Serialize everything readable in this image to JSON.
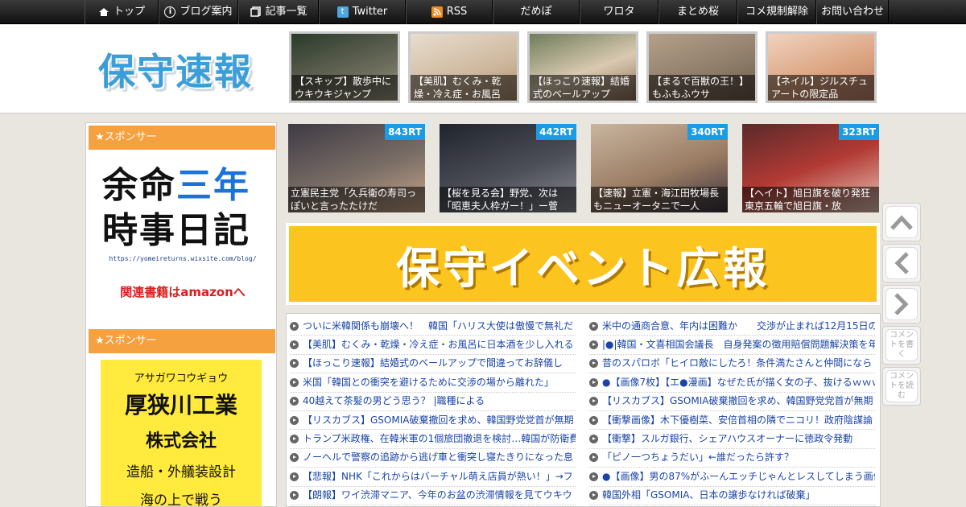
{
  "nav": {
    "items": [
      {
        "label": "トップ",
        "icon": "home-icon"
      },
      {
        "label": "ブログ案内",
        "icon": "info-icon"
      },
      {
        "label": "記事一覧",
        "icon": "list-icon"
      },
      {
        "label": "Twitter",
        "icon": "twitter-icon"
      },
      {
        "label": "RSS",
        "icon": "rss-icon"
      },
      {
        "label": "だめぽ"
      },
      {
        "label": "ワロタ"
      },
      {
        "label": "まとめ桜"
      },
      {
        "label": "コメ規制解除"
      },
      {
        "label": "お問い合わせ"
      }
    ]
  },
  "header": {
    "logo": "保守速報",
    "thumbs": [
      {
        "caption": "【スキップ】散歩中にウキウキジャンプ"
      },
      {
        "caption": "【美肌】むくみ・乾燥・冷え症・お風呂"
      },
      {
        "caption": "【ほっこり速報】結婚式のベールアップ"
      },
      {
        "caption": "【まるで百獣の王！】もふもふウサ"
      },
      {
        "caption": "【ネイル】ジルスチュアートの限定品"
      }
    ]
  },
  "sidebar": {
    "sponsor_label": "★スポンサー",
    "ad1": {
      "line1_a": "余命",
      "line1_b": "三年",
      "line2": "時事日記",
      "url": "https://yomeireturns.wixsite.com/blog/",
      "amazon": "関連書籍はamazonへ"
    },
    "ad2": {
      "kana": "アサガワコウギョウ",
      "company": "厚狭川工業",
      "company2": "株式会社",
      "business": "造船・外艤装設計",
      "more": "海の上で戦う"
    }
  },
  "rt_items": [
    {
      "rt": "843RT",
      "caption": "立憲民主党「久兵衛の寿司っぽいと言ったたけだ"
    },
    {
      "rt": "442RT",
      "caption": "【桜を見る会】野党、次は「昭恵夫人枠ガー！」ー菅"
    },
    {
      "rt": "340RT",
      "caption": "【速報】立憲・海江田牧場長もニューオータニで一人"
    },
    {
      "rt": "323RT",
      "caption": "【ヘイト】旭日旗を破り発狂　東京五輪で旭日旗・放"
    }
  ],
  "banner": {
    "text": "保守イベント広報"
  },
  "headlines_left": [
    "ついに米韓関係も崩壊へ！　韓国「ハリス大使は傲慢で無礼だ",
    "【美肌】むくみ・乾燥・冷え症・お風呂に日本酒を少し入れる",
    "【ほっこり速報】結婚式のベールアップで間違ってお辞儀し",
    "米国「韓国との衝突を避けるために交渉の場から離れた」",
    "40越えて茶髪の男どう思う？ |職種による",
    "【リスカブス】GSOMIA破棄撤回を求め、韓国野党党首が無期",
    "トランプ米政権、在韓米軍の1個旅団撤退を検討…韓国が防衛費",
    "ノーヘルで警察の追跡から逃げ車と衝突し寝たきりになった息",
    "【悲報】NHK「これからはバーチャル萌え店員が熱い！」→フ",
    "【朗報】ワイ渋滞マニア、今年のお盆の渋滞情報を見てウキウ"
  ],
  "headlines_right": [
    "米中の通商合意、年内は困難か　　交渉が止まれば12月15日の",
    "|●|韓国・文喜相国会議長　自身発案の徴用賠償問題解決策を年",
    "昔のスパロボ「ヒイロ敵にしたろ！条件満たさんと仲間になら",
    "●【画像7枚】【エ●漫画】なぜた氏が描く女の子、抜けるｗｗｗ",
    "【リスカブス】GSOMIA破棄撤回を求め、韓国野党党首が無期",
    "【衝撃画像】木下優樹菜、安倍首相の隣でニコリ！政府陰謀論",
    "【衝撃】スルガ銀行、シェアハウスオーナーに徳政令発動",
    "「ピノ一つちょうだい」←誰だったら許す？",
    "●【画像】男の87%がふーんエッチじゃんとレスしてしまう画像",
    "韓国外相「GSOMIA、日本の譲歩なければ破棄」"
  ],
  "side_buttons": {
    "comment_write": "コメントを書く",
    "comment_read": "コメントを読む"
  }
}
